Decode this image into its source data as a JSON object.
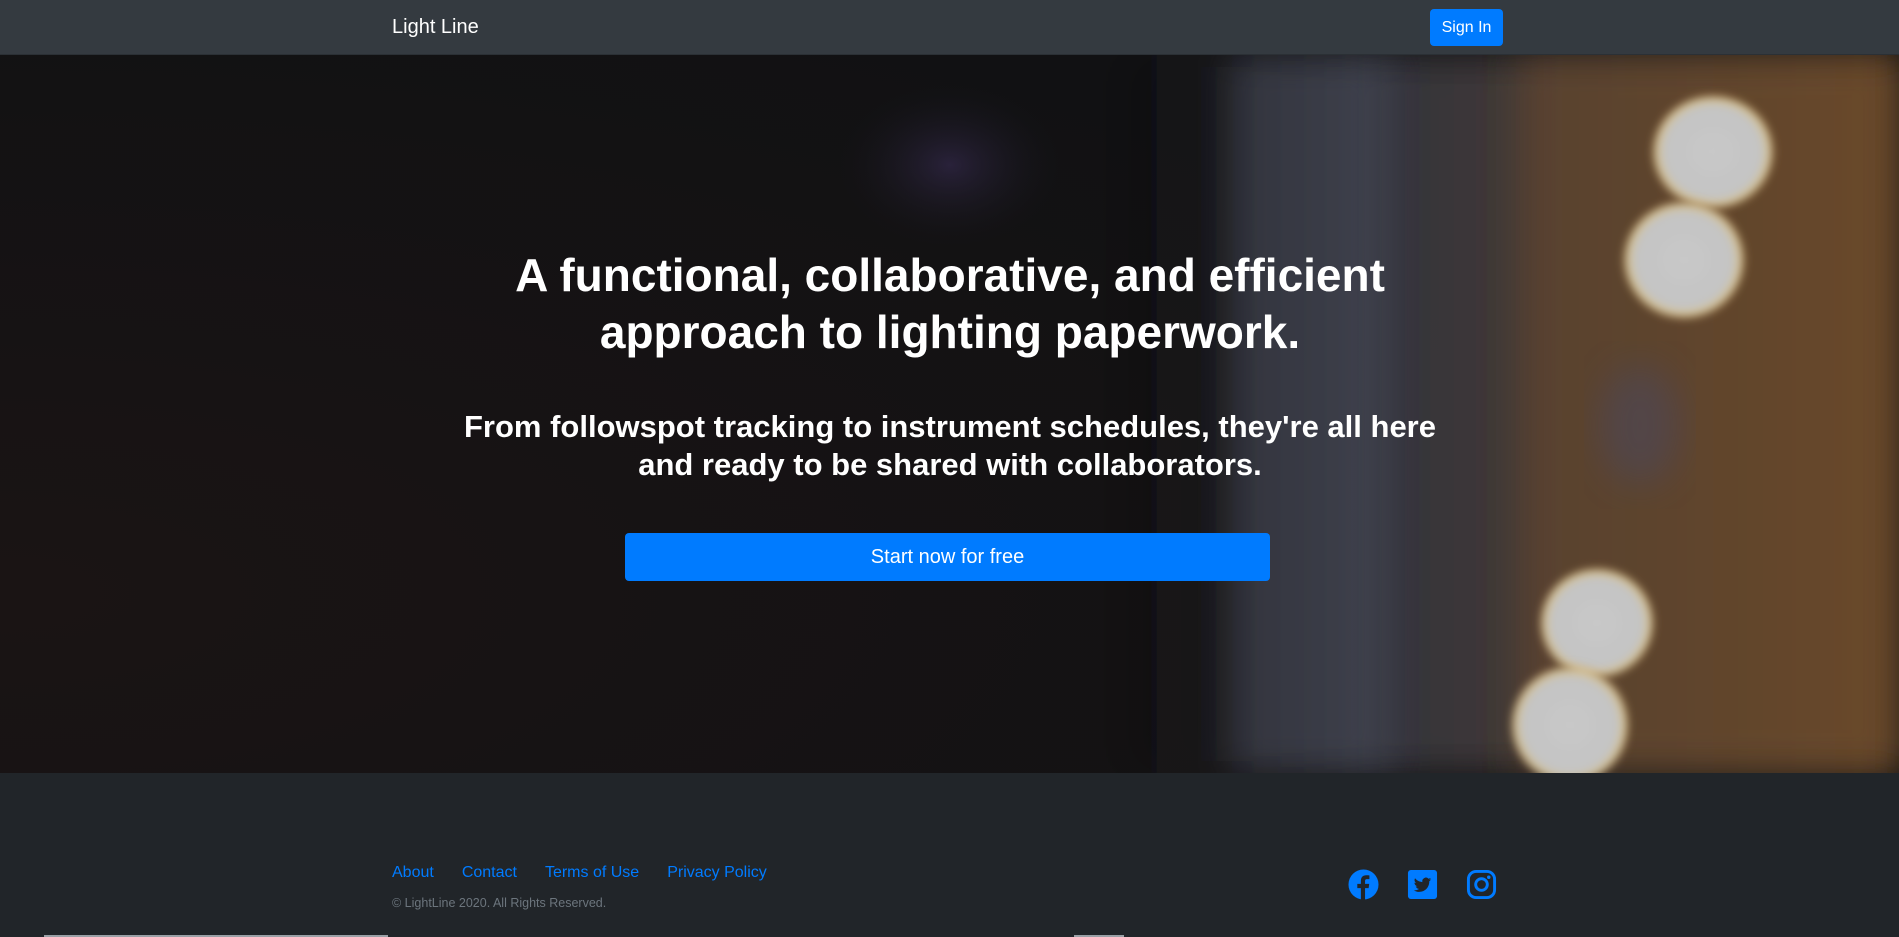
{
  "navbar": {
    "brand": "Light Line",
    "signin_label": "Sign In"
  },
  "hero": {
    "title": "A functional, collaborative, and efficient approach to lighting paperwork.",
    "subtitle": "From followspot tracking to instrument schedules, they're all here and ready to be shared with collaborators.",
    "cta_label": "Start now for free"
  },
  "footer": {
    "links": [
      "About",
      "Contact",
      "Terms of Use",
      "Privacy Policy"
    ],
    "copyright": "© LightLine 2020. All Rights Reserved.",
    "social": [
      "facebook-icon",
      "twitter-icon",
      "instagram-icon"
    ]
  },
  "colors": {
    "navbar_bg": "#343a40",
    "footer_bg": "#212529",
    "accent": "#007bff",
    "link": "#007bff",
    "muted_text": "#6c757d"
  }
}
